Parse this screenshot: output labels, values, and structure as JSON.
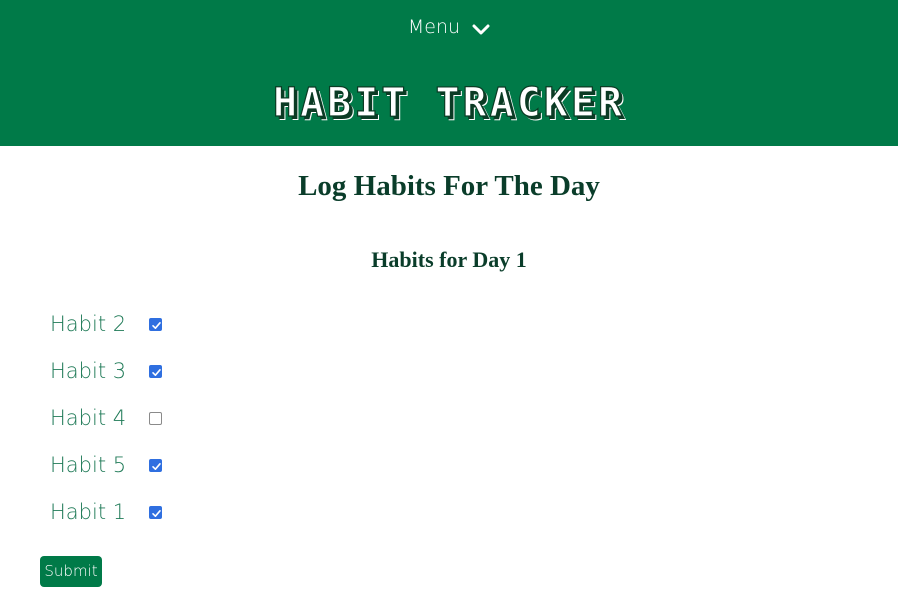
{
  "header": {
    "menu_label": "Menu",
    "menu_icon": "chevron-down-icon",
    "brand": "HABIT TRACKER",
    "background_color": "#007a48"
  },
  "main": {
    "title": "Log Habits For The Day",
    "subtitle": "Habits for Day 1",
    "habits": [
      {
        "label": "Habit 2",
        "checked": true
      },
      {
        "label": "Habit 3",
        "checked": true
      },
      {
        "label": "Habit 4",
        "checked": false
      },
      {
        "label": "Habit 5",
        "checked": true
      },
      {
        "label": "Habit 1",
        "checked": true
      }
    ],
    "submit_label": "Submit"
  },
  "colors": {
    "accent": "#007a48",
    "heading": "#0a3d2a",
    "habit_text": "#1f7a57",
    "checkbox_checked": "#2f6fe0"
  }
}
